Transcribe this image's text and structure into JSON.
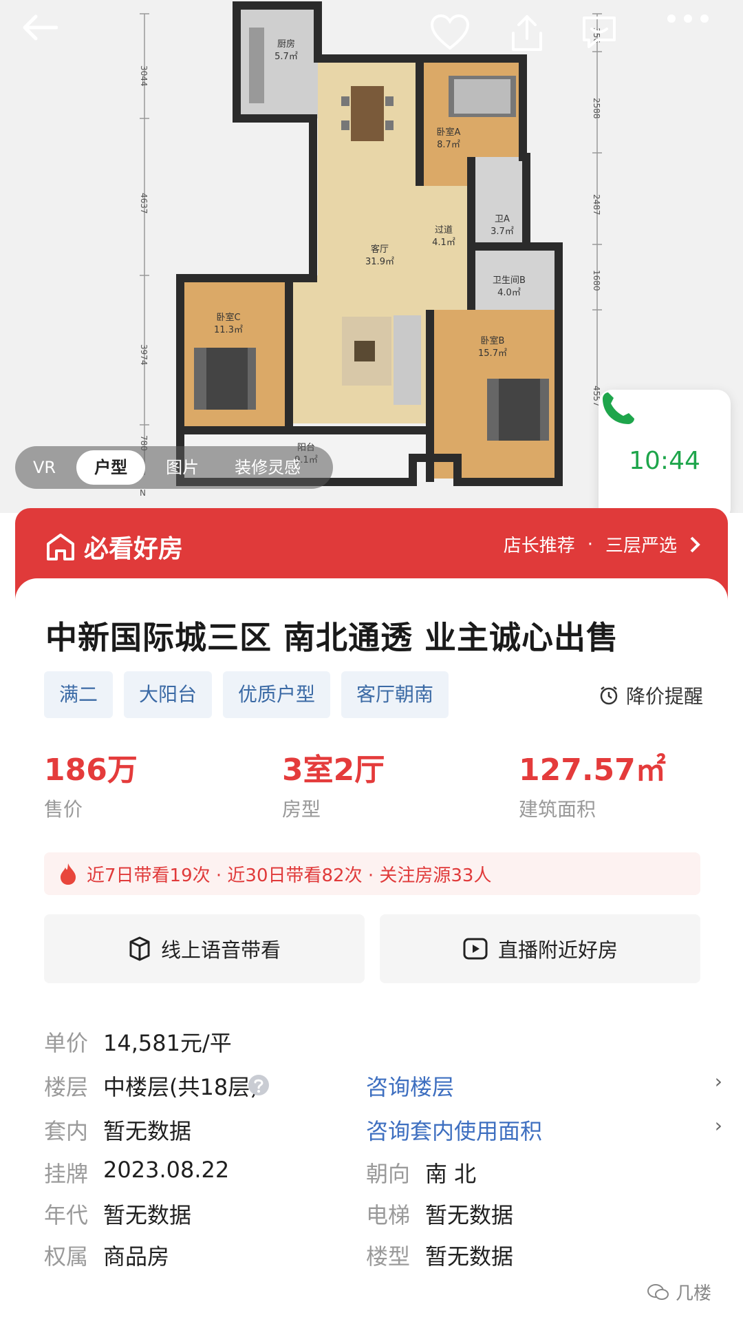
{
  "nav": {
    "back_icon": "back-arrow-icon",
    "actions": [
      "heart-icon",
      "share-icon",
      "message-icon",
      "more-icon"
    ]
  },
  "floorplan": {
    "rooms": [
      {
        "name": "厨房",
        "area": "5.7㎡"
      },
      {
        "name": "卧室A",
        "area": "8.7㎡"
      },
      {
        "name": "卫A",
        "area": "3.7㎡"
      },
      {
        "name": "过道",
        "area": "4.1㎡"
      },
      {
        "name": "客厅",
        "area": "31.9㎡"
      },
      {
        "name": "卫生间B",
        "area": "4.0㎡"
      },
      {
        "name": "卧室C",
        "area": "11.3㎡"
      },
      {
        "name": "卧室B",
        "area": "15.7㎡"
      },
      {
        "name": "阳台",
        "area": "9.1㎡"
      }
    ],
    "dims_left": [
      "3044",
      "4637",
      "3974",
      "780"
    ],
    "dims_right": [
      "356",
      "2588",
      "2487",
      "1680",
      "4557"
    ],
    "north": "N"
  },
  "media_tabs": [
    "VR",
    "户型",
    "图片",
    "装修灵感"
  ],
  "call": {
    "time": "10:44"
  },
  "banner": {
    "title": "必看好房",
    "right_a": "店长推荐",
    "dot": "·",
    "right_b": "三层严选"
  },
  "listing": {
    "title": "中新国际城三区 南北通透 业主诚心出售",
    "tags": [
      "满二",
      "大阳台",
      "优质户型",
      "客厅朝南"
    ],
    "price_alert": "降价提醒",
    "stats": [
      {
        "value": "186万",
        "label": "售价"
      },
      {
        "value": "3室2厅",
        "label": "房型"
      },
      {
        "value": "127.57㎡",
        "label": "建筑面积"
      }
    ],
    "heat": "近7日带看19次 · 近30日带看82次 · 关注房源33人",
    "buttons": [
      "线上语音带看",
      "直播附近好房"
    ],
    "details": {
      "unit_price_k": "单价",
      "unit_price_v": "14,581元/平",
      "floor_k": "楼层",
      "floor_v": "中楼层(共18层)",
      "floor_link": "咨询楼层",
      "inner_k": "套内",
      "inner_v": "暂无数据",
      "inner_link": "咨询套内使用面积",
      "listed_k": "挂牌",
      "listed_v": "2023.08.22",
      "orient_k": "朝向",
      "orient_v": "南 北",
      "year_k": "年代",
      "year_v": "暂无数据",
      "elevator_k": "电梯",
      "elevator_v": "暂无数据",
      "owner_k": "权属",
      "owner_v": "商品房",
      "type_k": "楼型",
      "type_v": "暂无数据"
    }
  },
  "watermark": "几楼"
}
